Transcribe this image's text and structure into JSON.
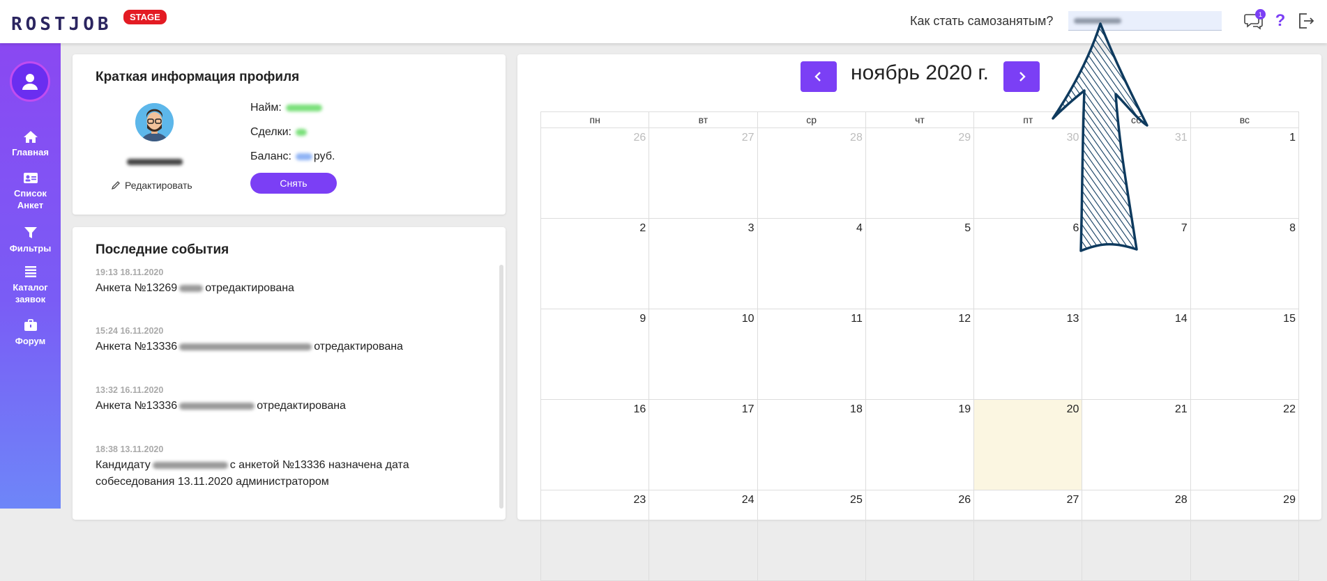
{
  "header": {
    "logo_text": "ROSTJOB",
    "stage_badge": "STAGE",
    "how_link": "Как стать самозанятым?",
    "notifications_count": "1",
    "help_label": "?"
  },
  "sidebar": {
    "items": [
      {
        "label": "Главная",
        "icon": "home-icon"
      },
      {
        "label": "Список Анкет",
        "icon": "id-card-icon"
      },
      {
        "label": "Фильтры",
        "icon": "filter-icon"
      },
      {
        "label": "Каталог заявок",
        "icon": "list-icon"
      },
      {
        "label": "Форум",
        "icon": "briefcase-icon"
      }
    ]
  },
  "profile": {
    "title": "Краткая информация профиля",
    "edit_label": "Редактировать",
    "hire_label": "Найм:",
    "deals_label": "Сделки:",
    "balance_label": "Баланс:",
    "balance_unit": "руб.",
    "withdraw_label": "Снять"
  },
  "events": {
    "title": "Последние события",
    "items": [
      {
        "time": "19:13 18.11.2020",
        "text_before": "Анкета №13269",
        "text_after": "отредактирована"
      },
      {
        "time": "15:24 16.11.2020",
        "text_before": "Анкета №13336",
        "text_after": "отредактирована"
      },
      {
        "time": "13:32 16.11.2020",
        "text_before": "Анкета №13336",
        "text_after": "отредактирована"
      },
      {
        "time": "18:38 13.11.2020",
        "text_before": "Кандидату",
        "text_after": "с анкетой №13336 назначена дата собеседования 13.11.2020 администратором"
      }
    ]
  },
  "calendar": {
    "title": "ноябрь 2020 г.",
    "weekdays": [
      "пн",
      "вт",
      "ср",
      "чт",
      "пт",
      "сб",
      "вс"
    ],
    "weeks": [
      [
        {
          "d": "26",
          "o": true
        },
        {
          "d": "27",
          "o": true
        },
        {
          "d": "28",
          "o": true
        },
        {
          "d": "29",
          "o": true
        },
        {
          "d": "30",
          "o": true
        },
        {
          "d": "31",
          "o": true
        },
        {
          "d": "1"
        }
      ],
      [
        {
          "d": "2"
        },
        {
          "d": "3"
        },
        {
          "d": "4"
        },
        {
          "d": "5"
        },
        {
          "d": "6"
        },
        {
          "d": "7"
        },
        {
          "d": "8"
        }
      ],
      [
        {
          "d": "9"
        },
        {
          "d": "10"
        },
        {
          "d": "11"
        },
        {
          "d": "12"
        },
        {
          "d": "13"
        },
        {
          "d": "14"
        },
        {
          "d": "15"
        }
      ],
      [
        {
          "d": "16"
        },
        {
          "d": "17"
        },
        {
          "d": "18"
        },
        {
          "d": "19"
        },
        {
          "d": "20",
          "today": true
        },
        {
          "d": "21"
        },
        {
          "d": "22"
        }
      ],
      [
        {
          "d": "23"
        },
        {
          "d": "24"
        },
        {
          "d": "25"
        },
        {
          "d": "26"
        },
        {
          "d": "27"
        },
        {
          "d": "28"
        },
        {
          "d": "29"
        }
      ]
    ],
    "today_color": "#fbf6e1"
  },
  "accent_color": "#7b3ff5"
}
